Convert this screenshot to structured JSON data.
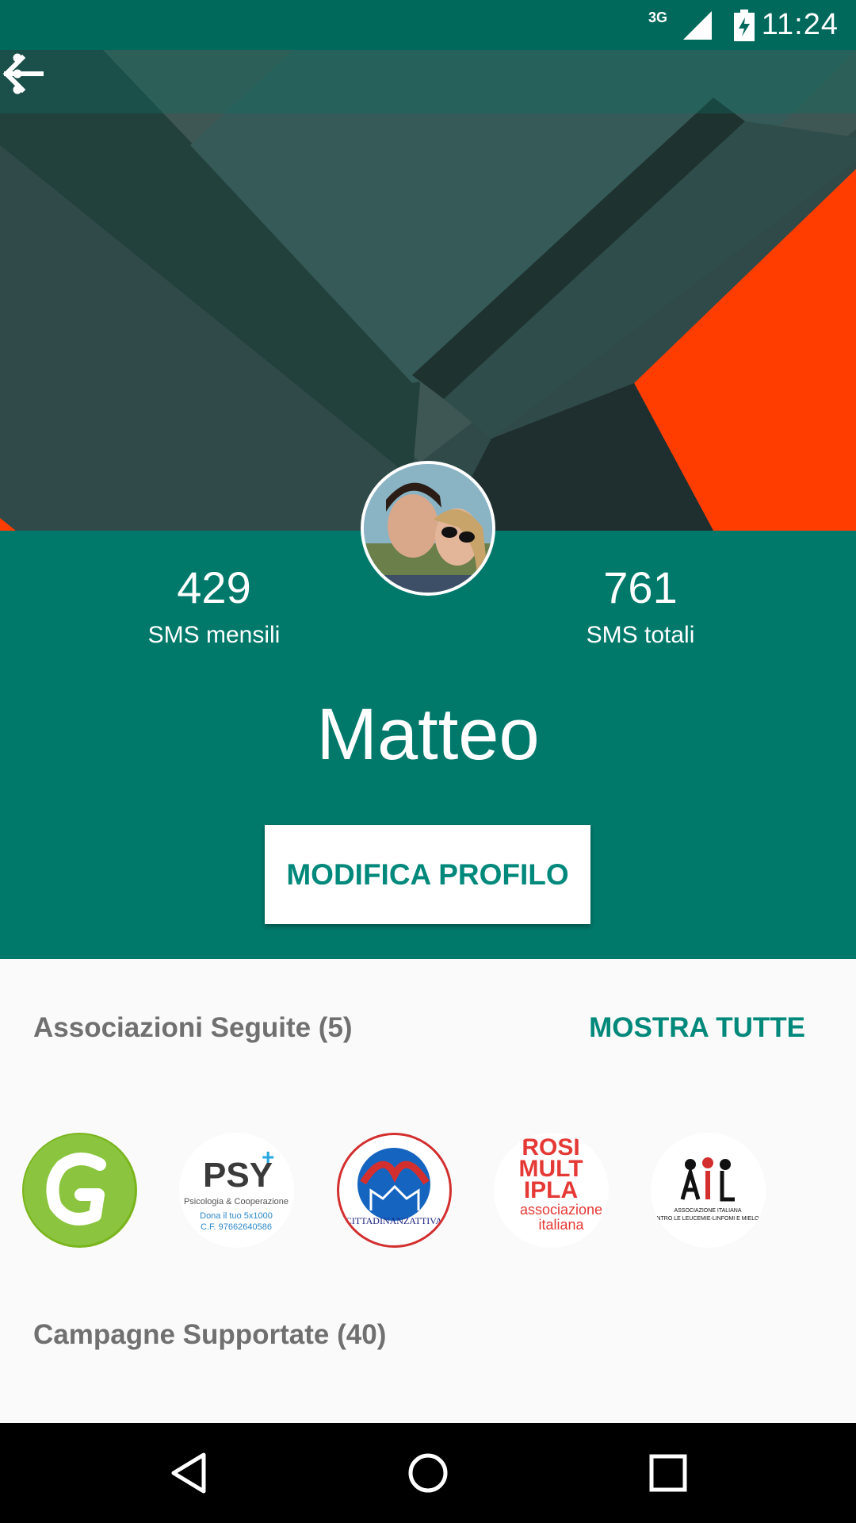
{
  "status_bar": {
    "network": "3G",
    "time": "11:24"
  },
  "stats": {
    "monthly": {
      "value": "429",
      "label": "SMS mensili"
    },
    "total": {
      "value": "761",
      "label": "SMS totali"
    }
  },
  "profile": {
    "name": "Matteo",
    "edit_label": "MODIFICA PROFILO"
  },
  "associations": {
    "title": "Associazioni Seguite (5)",
    "show_all": "MOSTRA TUTTE",
    "logos": [
      {
        "name": "G"
      },
      {
        "name": "PSY",
        "line1": "Psicologia & Cooperazione",
        "line2": "Dona il tuo 5x1000",
        "line3": "C.F. 97662640586"
      },
      {
        "name": "CITTADINANZATTIVA"
      },
      {
        "name": "ROSI MULTIPLA",
        "sub1": "associazione",
        "sub2": "italiana"
      },
      {
        "name": "AIL",
        "sub": "ASSOCIAZIONE ITALIANA CONTRO LE LEUCEMIE-LINFOMI E MIELOMA"
      }
    ]
  },
  "campaigns": {
    "title": "Campagne Supportate (40)"
  },
  "colors": {
    "primary": "#00796b",
    "primary_dark": "#00695c",
    "accent": "#00897b",
    "orange": "#ff3d00"
  }
}
